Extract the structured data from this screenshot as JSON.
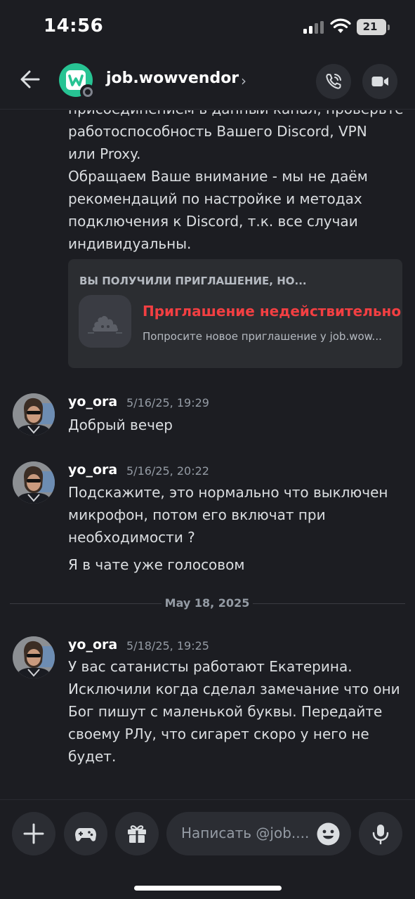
{
  "status_bar": {
    "time": "14:56",
    "battery": "21"
  },
  "header": {
    "channel_name": "job.wowvendor",
    "chevron": "›",
    "avatar_color": "#27c393"
  },
  "messages": {
    "partial_lines": [
      "присоединением в данный канал, проверьте",
      "работоспособность Вашего Discord, VPN",
      "или Proxy.",
      "Обращаем Ваше внимание - мы не даём",
      "рекомендаций по настройке и методах",
      "подключения к Discord, т.к. все случаи",
      "индивидуальны."
    ],
    "invite": {
      "heading": "ВЫ ПОЛУЧИЛИ ПРИГЛАШЕНИЕ, НО...",
      "title": "Приглашение недействительно",
      "subtitle": "Попросите новое приглашение у job.wow...",
      "title_color": "#f23f42"
    },
    "list": [
      {
        "author": "yo_ora",
        "time": "5/16/25, 19:29",
        "lines": [
          "Добрый вечер"
        ]
      },
      {
        "author": "yo_ora",
        "time": "5/16/25, 20:22",
        "lines": [
          "Подскажите, это нормально что выключен",
          "микрофон, потом его включат при",
          "необходимости ?"
        ],
        "followup": "Я в чате уже голосовом"
      },
      {
        "author": "yo_ora",
        "time": "5/18/25, 19:25",
        "lines": [
          "У вас сатанисты работают Екатерина.",
          "Исключили когда сделал замечание что они",
          "Бог пишут с маленькой буквы. Передайте",
          "своему РЛу, что сигарет скоро у него не",
          "будет."
        ]
      }
    ],
    "date_divider": "May 18, 2025"
  },
  "composer": {
    "placeholder": "Написать @job...."
  },
  "icons": {
    "back": "arrow-left-icon",
    "call": "phone-call-icon",
    "video": "video-camera-icon",
    "plus": "plus-icon",
    "games": "gamepad-icon",
    "gift": "gift-icon",
    "emoji": "emoji-icon",
    "mic": "microphone-icon"
  }
}
